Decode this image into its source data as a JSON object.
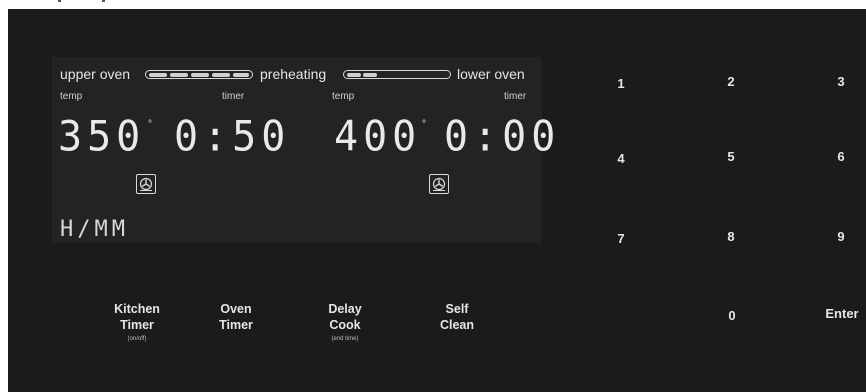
{
  "display": {
    "upper_oven_label": "upper oven",
    "preheating_label": "preheating",
    "lower_oven_label": "lower oven",
    "upper_preheat_progress": 1.0,
    "lower_preheat_progress": 0.3,
    "upper": {
      "temp_label": "temp",
      "timer_label": "timer",
      "temp_value": "350",
      "timer_value": "0:50"
    },
    "lower": {
      "temp_label": "temp",
      "timer_label": "timer",
      "temp_value": "400",
      "timer_value": "0:00"
    },
    "mode_text": "H/MM",
    "fan_icon": "convection-fan-icon"
  },
  "keypad": {
    "keys": [
      "1",
      "2",
      "3",
      "4",
      "5",
      "6",
      "7",
      "8",
      "9",
      "0",
      "Enter"
    ]
  },
  "functions": [
    {
      "line1": "Kitchen",
      "line2": "Timer",
      "sub": "(on/off)"
    },
    {
      "line1": "Oven",
      "line2": "Timer",
      "sub": ""
    },
    {
      "line1": "Delay",
      "line2": "Cook",
      "sub": "(end time)"
    },
    {
      "line1": "Self",
      "line2": "Clean",
      "sub": ""
    }
  ],
  "colors": {
    "panel": "#1b1b1b",
    "display": "#232323",
    "text": "#e6e6e6"
  }
}
